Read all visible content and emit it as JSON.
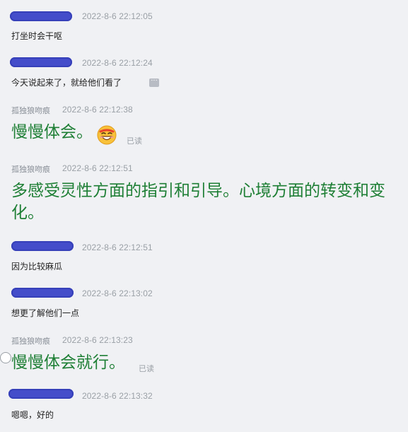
{
  "messages": [
    {
      "sender": "",
      "timestamp": "2022-8-6 22:12:05",
      "text": "打坐时会干呕"
    },
    {
      "sender": "",
      "timestamp": "2022-8-6 22:12:24",
      "text": "今天说起来了，就给他们看了"
    },
    {
      "sender": "孤独狼吻痕",
      "timestamp": "2022-8-6 22:12:38",
      "text": "慢慢体会。",
      "status": "已读",
      "emoji": "grinning-emoji"
    },
    {
      "sender": "孤独狼吻痕",
      "timestamp": "2022-8-6 22:12:51",
      "text": "多感受灵性方面的指引和引导。心境方面的转变和变化。"
    },
    {
      "sender": "",
      "timestamp": "2022-8-6 22:12:51",
      "text": "因为比较麻瓜"
    },
    {
      "sender": "",
      "timestamp": "2022-8-6 22:13:02",
      "text": "想更了解他们一点"
    },
    {
      "sender": "孤独狼吻痕",
      "timestamp": "2022-8-6 22:13:23",
      "text": "慢慢体会就行。",
      "status": "已读"
    },
    {
      "sender": "",
      "timestamp": "2022-8-6 22:13:32",
      "text": "嗯嗯，好的"
    }
  ],
  "more_button": {
    "label": "···",
    "icon": "more-icon"
  },
  "colors": {
    "background": "#f0f1f4",
    "redacted_name": "#3b45c8",
    "reply_text": "#1e7f35",
    "timestamp": "#9aa0a6"
  }
}
